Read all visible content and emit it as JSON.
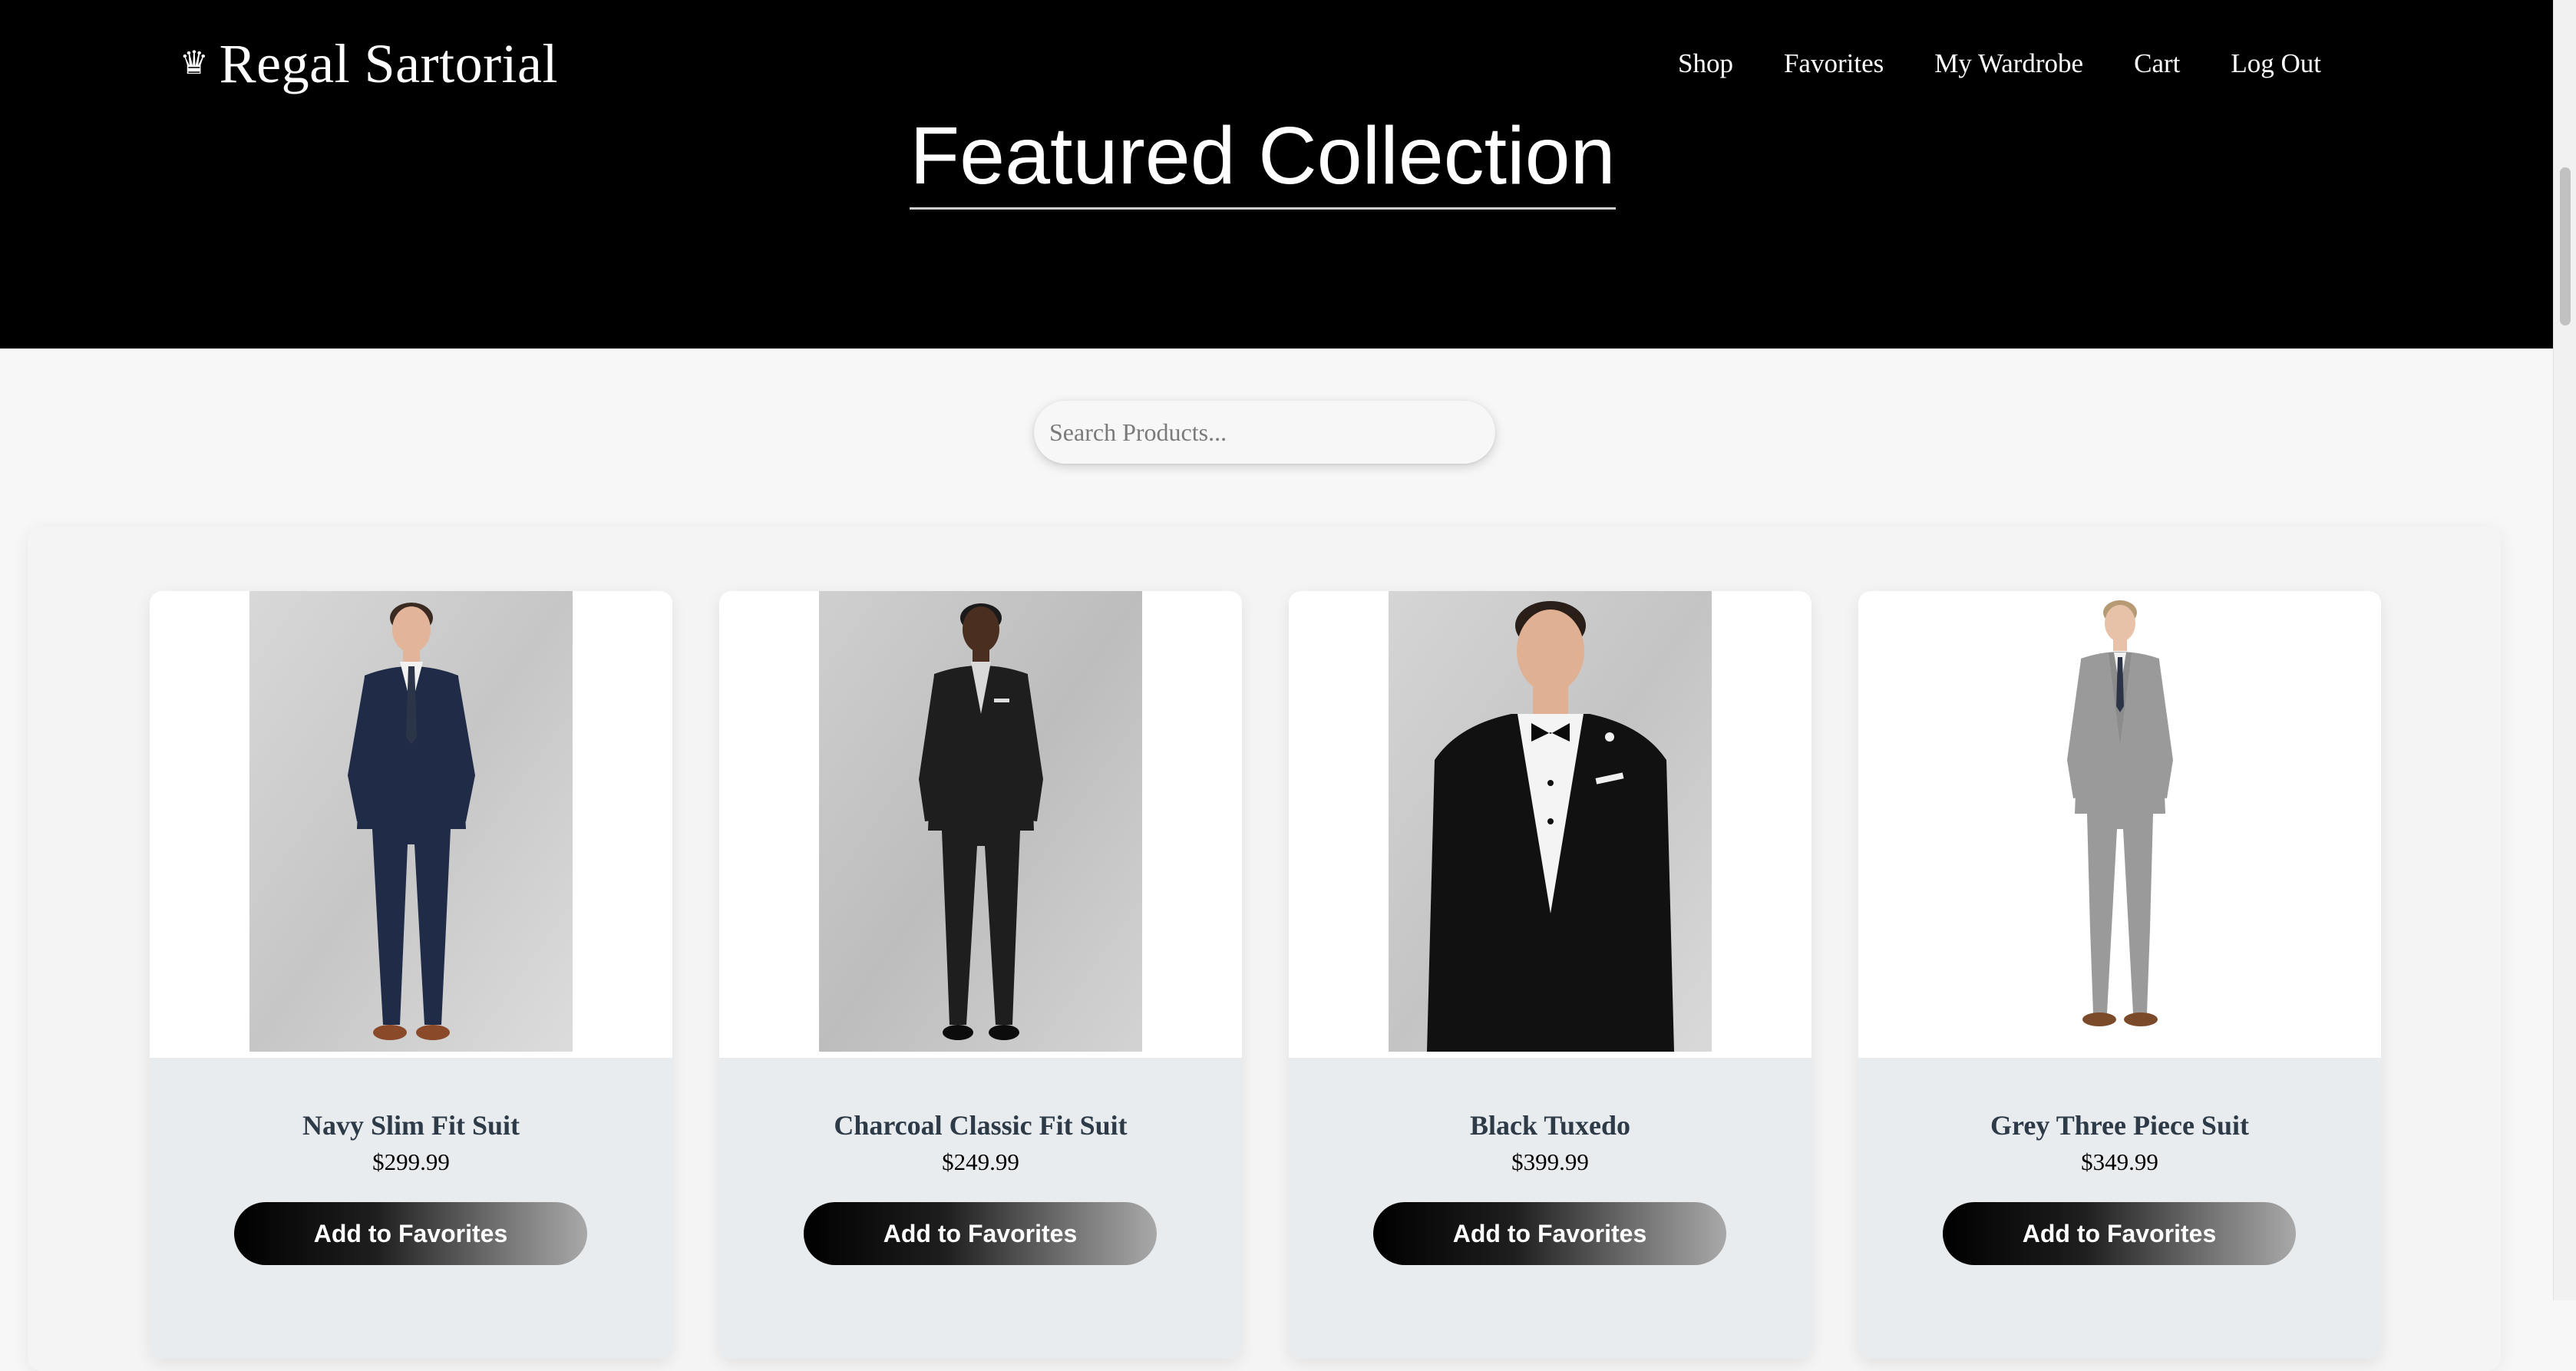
{
  "brand": {
    "crown_icon": "♛",
    "name": "Regal Sartorial"
  },
  "nav": [
    "Shop",
    "Favorites",
    "My Wardrobe",
    "Cart",
    "Log Out"
  ],
  "hero": {
    "title": "Featured Collection"
  },
  "search": {
    "placeholder": "Search Products..."
  },
  "products": [
    {
      "name": "Navy Slim Fit Suit",
      "price": "$299.99",
      "button": "Add to Favorites",
      "suit_color": "#1f2b47"
    },
    {
      "name": "Charcoal Classic Fit Suit",
      "price": "$249.99",
      "button": "Add to Favorites",
      "suit_color": "#1e1e1e"
    },
    {
      "name": "Black Tuxedo",
      "price": "$399.99",
      "button": "Add to Favorites",
      "suit_color": "#111111"
    },
    {
      "name": "Grey Three Piece Suit",
      "price": "$349.99",
      "button": "Add to Favorites",
      "suit_color": "#9a9a9a"
    }
  ],
  "colors": {
    "header_bg": "#000000",
    "page_bg": "#f7f7f7",
    "card_info_bg": "#e9ecee",
    "product_name": "#2d3a48"
  }
}
